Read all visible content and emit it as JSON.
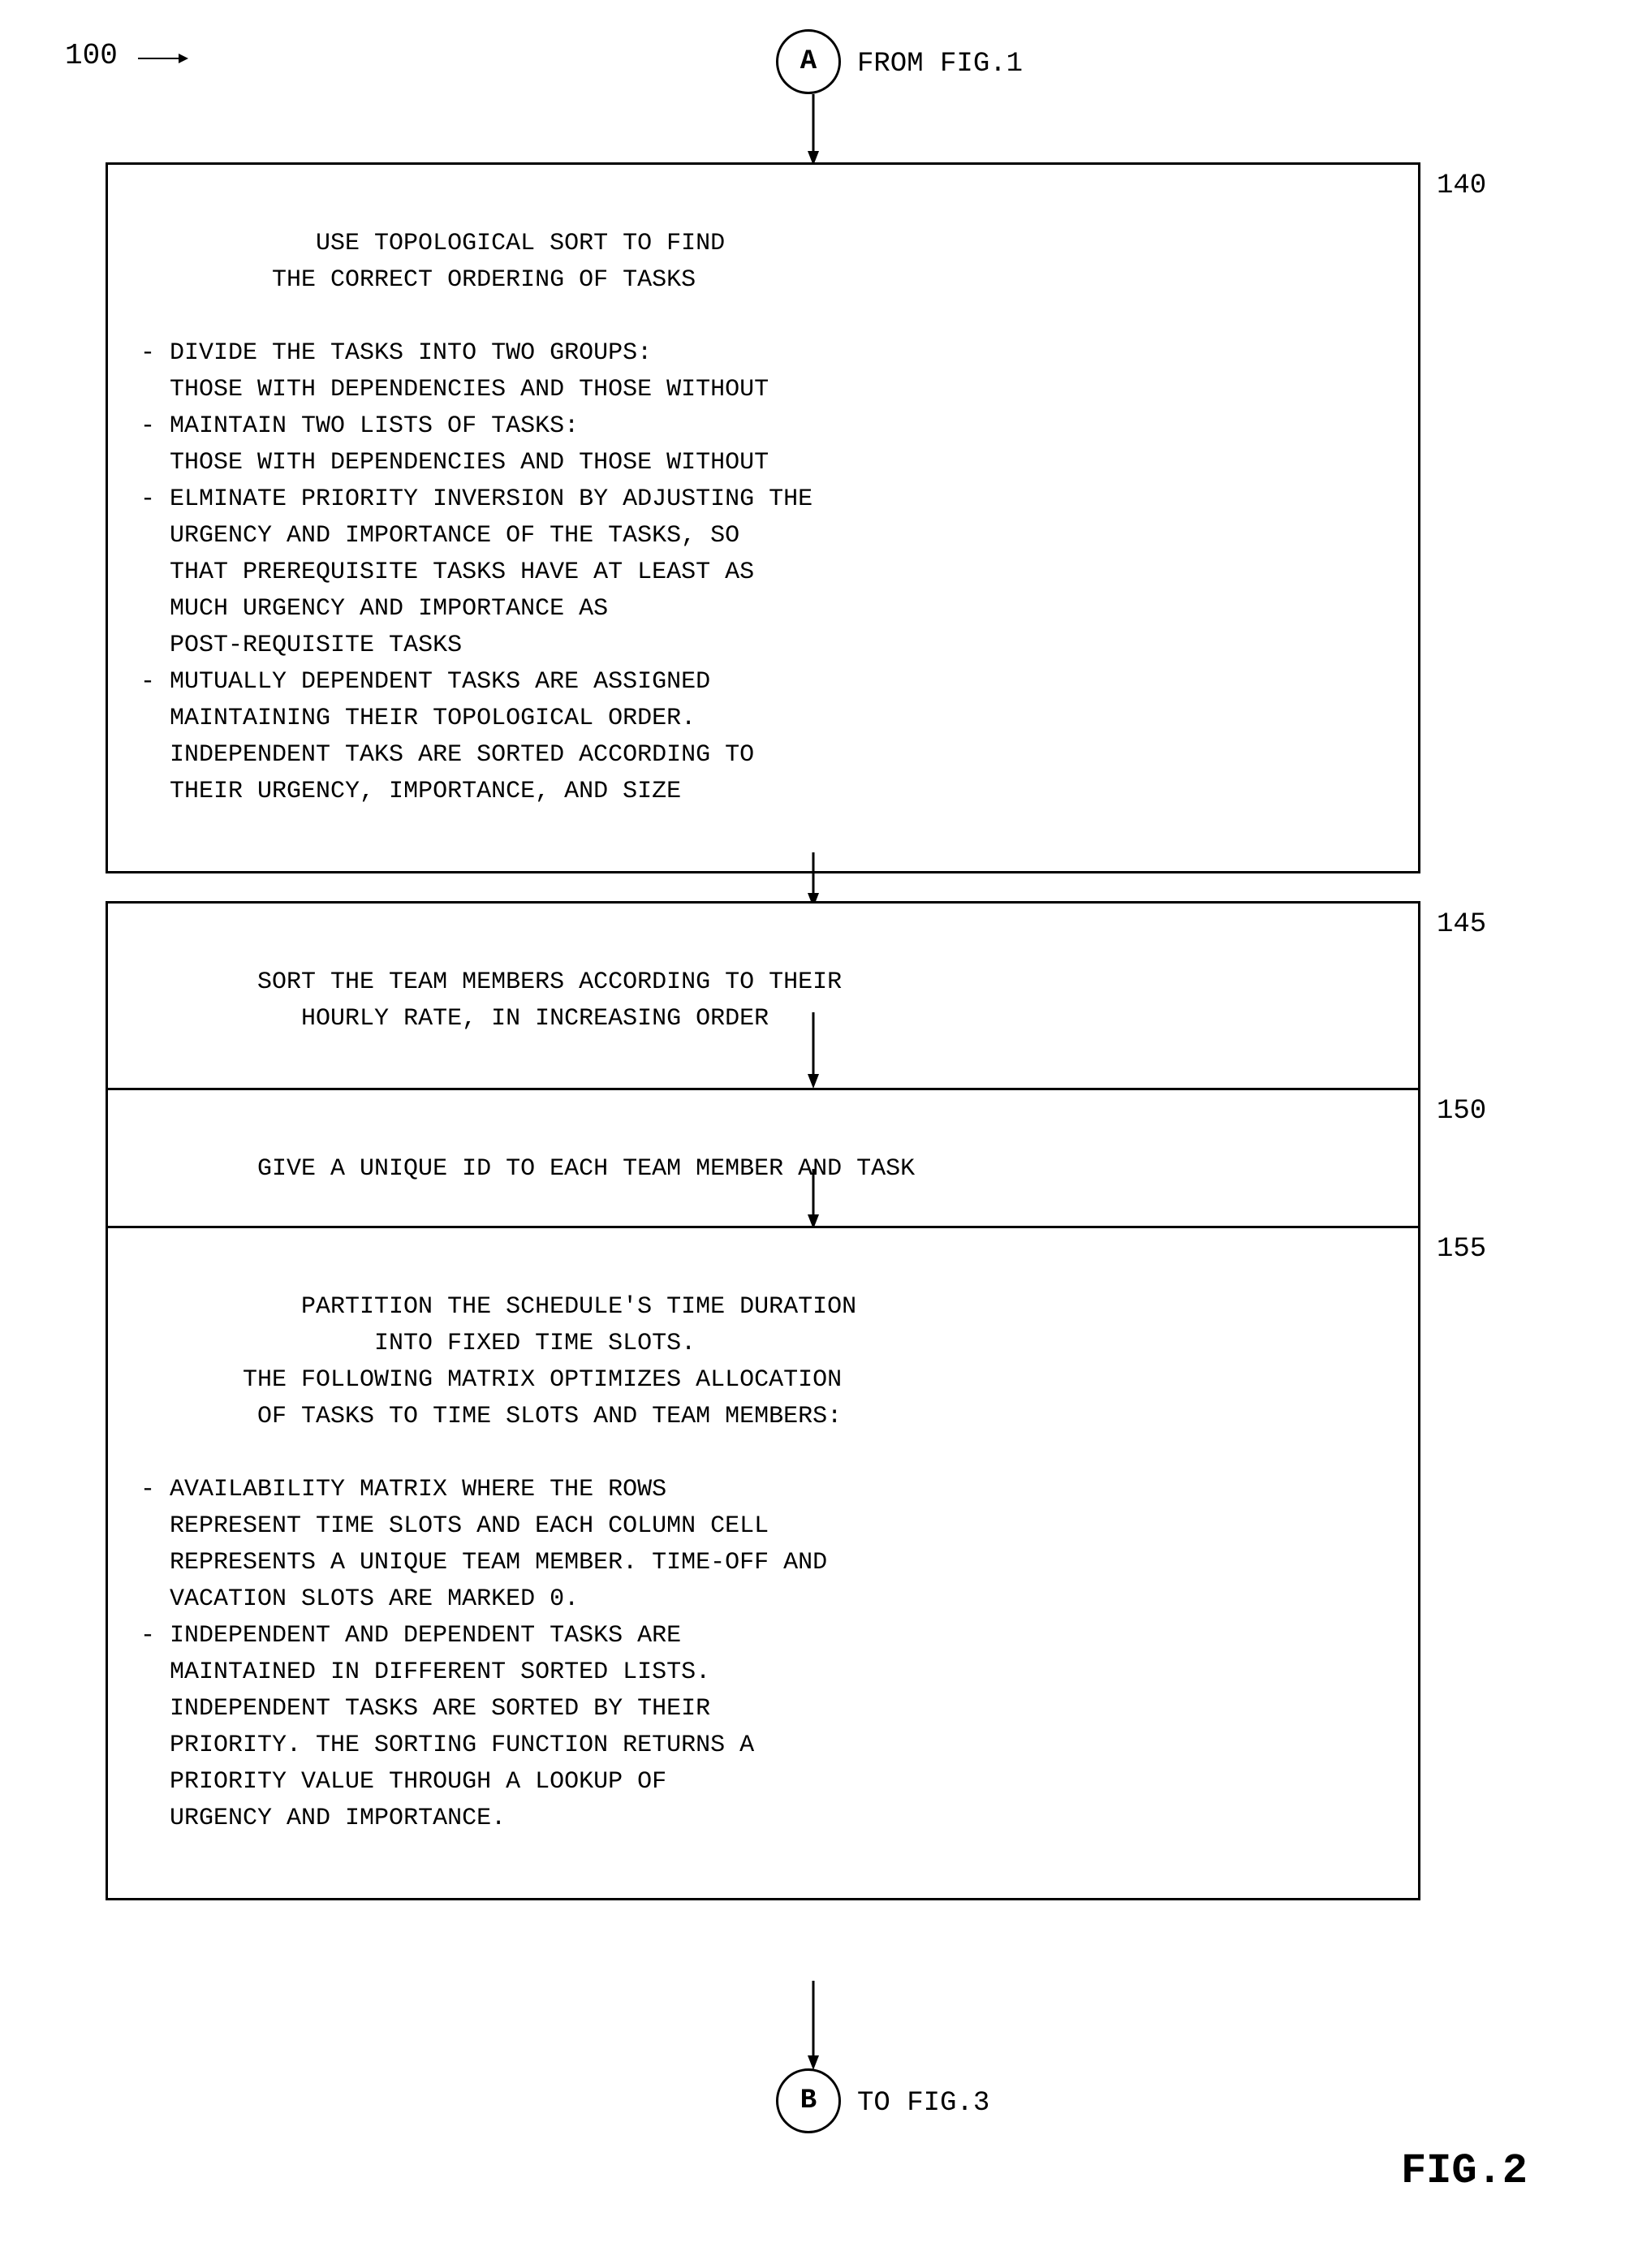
{
  "figure": {
    "main_label": "100",
    "fig_name": "FIG.2",
    "connector_a": "A",
    "connector_b": "B",
    "from_fig": "FROM FIG.1",
    "to_fig": "TO FIG.3"
  },
  "boxes": {
    "box_140": {
      "step": "140",
      "content": "        USE TOPOLOGICAL SORT TO FIND\n         THE CORRECT ORDERING OF TASKS\n\n- DIVIDE THE TASKS INTO TWO GROUPS:\n  THOSE WITH DEPENDENCIES AND THOSE WITHOUT\n- MAINTAIN TWO LISTS OF TASKS:\n  THOSE WITH DEPENDENCIES AND THOSE WITHOUT\n- ELMINATE PRIORITY INVERSION BY ADJUSTING THE\n  URGENCY AND IMPORTANCE OF THE TASKS, SO\n  THAT PREREQUISITE TASKS HAVE AT LEAST AS\n  MUCH URGENCY AND IMPORTANCE AS\n  POST-REQUISITE TASKS\n- MUTUALLY DEPENDENT TASKS ARE ASSIGNED\n  MAINTAINING THEIR TOPOLOGICAL ORDER.\n  INDEPENDENT TAKS ARE SORTED ACCORDING TO\n  THEIR URGENCY, IMPORTANCE, AND SIZE"
    },
    "box_145": {
      "step": "145",
      "content": "    SORT THE TEAM MEMBERS ACCORDING TO THEIR\n           HOURLY RATE, IN INCREASING ORDER"
    },
    "box_150": {
      "step": "150",
      "content": "    GIVE A UNIQUE ID TO EACH TEAM MEMBER AND TASK"
    },
    "box_155": {
      "step": "155",
      "content": "       PARTITION THE SCHEDULE'S TIME DURATION\n                INTO FIXED TIME SLOTS.\n       THE FOLLOWING MATRIX OPTIMIZES ALLOCATION\n        OF TASKS TO TIME SLOTS AND TEAM MEMBERS:\n\n- AVAILABILITY MATRIX WHERE THE ROWS\n  REPRESENT TIME SLOTS AND EACH COLUMN CELL\n  REPRESENTS A UNIQUE TEAM MEMBER. TIME-OFF AND\n  VACATION SLOTS ARE MARKED 0.\n- INDEPENDENT AND DEPENDENT TASKS ARE\n  MAINTAINED IN DIFFERENT SORTED LISTS.\n  INDEPENDENT TASKS ARE SORTED BY THEIR\n  PRIORITY. THE SORTING FUNCTION RETURNS A\n  PRIORITY VALUE THROUGH A LOOKUP OF\n  URGENCY AND IMPORTANCE."
    }
  }
}
